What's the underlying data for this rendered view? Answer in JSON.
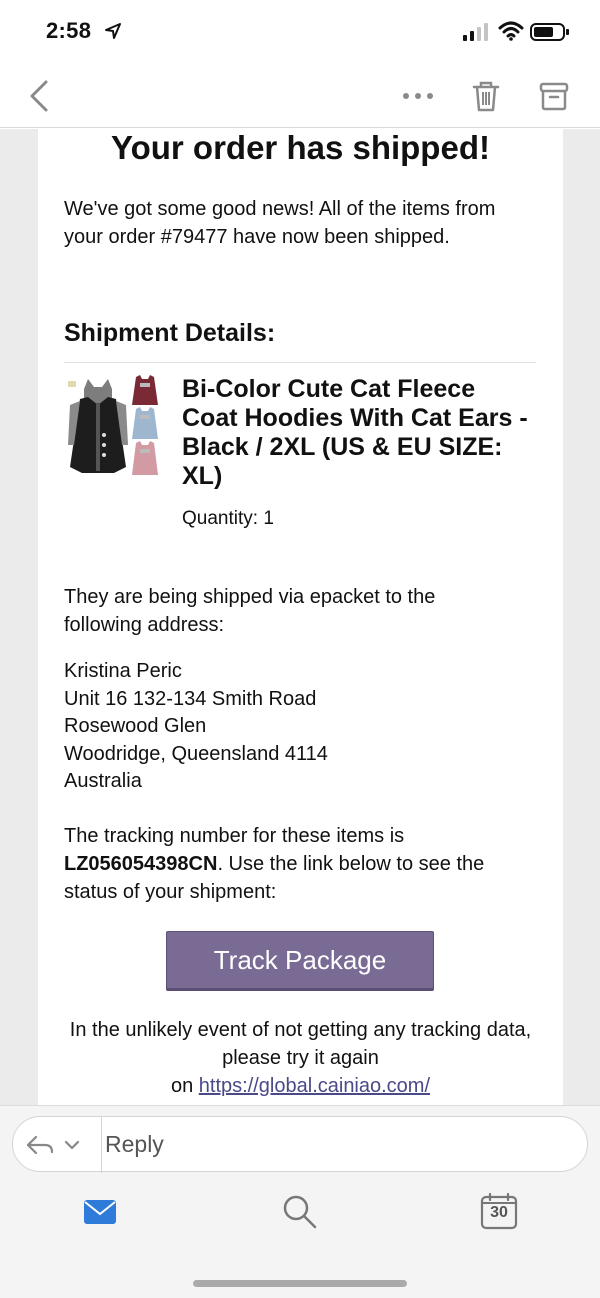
{
  "status_bar": {
    "time": "2:58"
  },
  "toolbar": {
    "icons": [
      "chevron-left-icon",
      "more-icon",
      "trash-icon",
      "archive-icon"
    ]
  },
  "email": {
    "title": "Your order has shipped!",
    "intro": "We've got some good news! All of the items from your order #79477 have now been shipped.",
    "shipment_heading": "Shipment Details:",
    "product": {
      "name": "Bi-Color Cute Cat Fleece Coat Hoodies With Cat Ears - Black / 2XL (US & EU SIZE: XL)",
      "quantity": "Quantity: 1"
    },
    "ship_via": "They are being shipped via epacket to the following address:",
    "address": {
      "name": "Kristina Peric",
      "line1": "Unit 16 132-134 Smith Road",
      "line2": "Rosewood Glen",
      "line3": "Woodridge, Queensland 4114",
      "country": "Australia"
    },
    "tracking": {
      "prefix": "The tracking number for these items is",
      "number": "LZ056054398CN",
      "suffix": ". Use the link below to see the status of your shipment:"
    },
    "track_button": "Track Package",
    "fallback": {
      "text": "In the unlikely event of not getting any tracking data, please try it again",
      "on": "on",
      "link": "https://global.cainiao.com/"
    }
  },
  "reply_bar": {
    "label": "Reply"
  },
  "tab_bar": {
    "calendar_day": "30"
  },
  "colors": {
    "button": "#7a6b95",
    "accent_blue": "#2f7bd9"
  }
}
